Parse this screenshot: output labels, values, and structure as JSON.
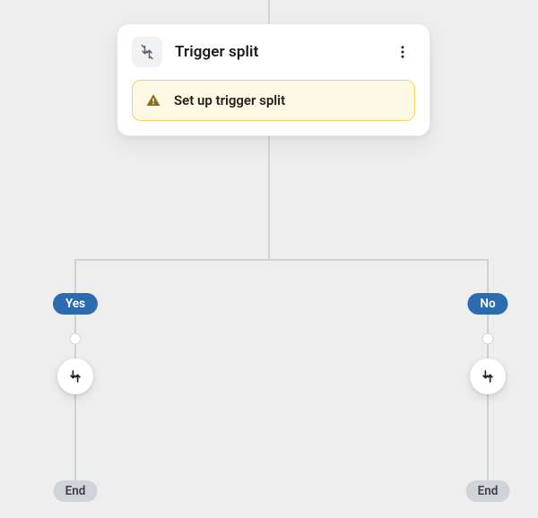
{
  "card": {
    "icon": "split-icon",
    "title": "Trigger split",
    "menu_icon": "kebab-icon",
    "alert": {
      "icon": "warning-icon",
      "text": "Set up trigger split"
    }
  },
  "branches": {
    "yes": {
      "label": "Yes",
      "action_icon": "split-icon",
      "terminal": "End"
    },
    "no": {
      "label": "No",
      "action_icon": "split-icon",
      "terminal": "End"
    }
  },
  "colors": {
    "brand_blue": "#2b6cb0",
    "warn_bg": "#fef9e4",
    "warn_border": "#f2d45e"
  }
}
